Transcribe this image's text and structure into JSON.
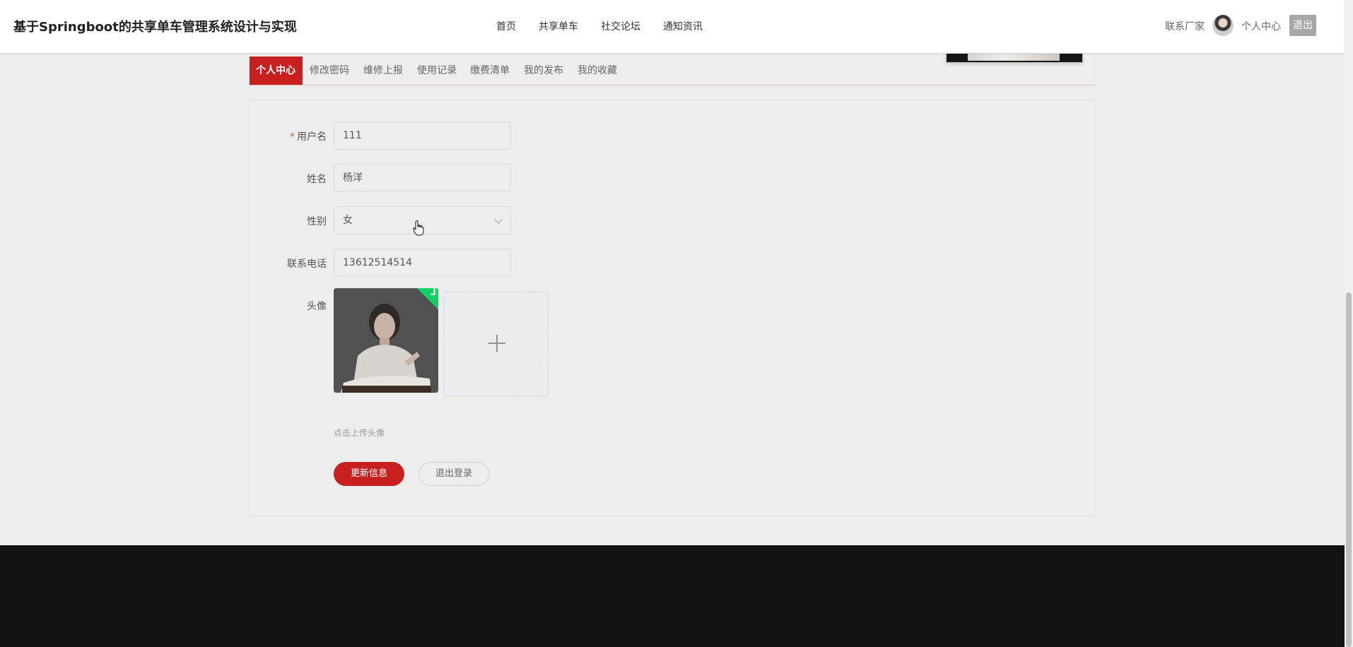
{
  "header": {
    "site_title": "基于Springboot的共享单车管理系统设计与实现",
    "nav": [
      "首页",
      "共享单车",
      "社交论坛",
      "通知资讯"
    ],
    "contact": "联系厂家",
    "personal_center": "个人中心",
    "logout": "退出"
  },
  "tabs": [
    "个人中心",
    "修改密码",
    "维修上报",
    "使用记录",
    "缴费清单",
    "我的发布",
    "我的收藏"
  ],
  "form": {
    "username_label": "用户名",
    "username_value": "111",
    "name_label": "姓名",
    "name_value": "杨洋",
    "gender_label": "性别",
    "gender_value": "女",
    "phone_label": "联系电话",
    "phone_value": "13612514514",
    "avatar_label": "头像",
    "upload_hint": "点击上传头像",
    "update_button": "更新信息",
    "logout_button": "退出登录"
  },
  "colors": {
    "accent": "#c8201f",
    "success": "#13ce66",
    "footer": "#121212"
  }
}
